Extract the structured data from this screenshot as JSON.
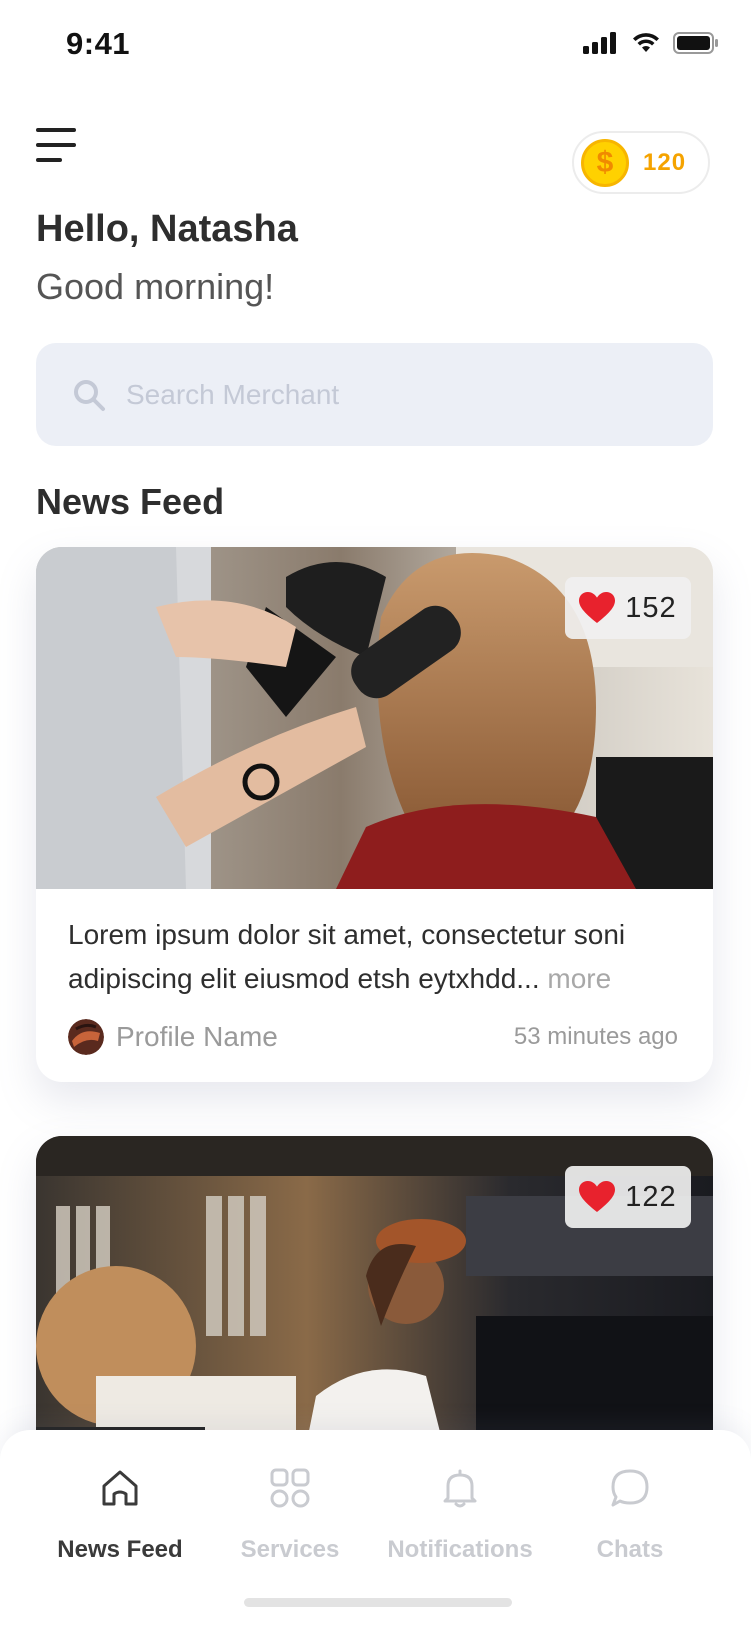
{
  "status_bar": {
    "time": "9:41"
  },
  "header": {
    "coins": "120",
    "coin_symbol": "$",
    "greeting": "Hello, Natasha",
    "subgreeting": "Good morning!"
  },
  "search": {
    "placeholder": "Search Merchant"
  },
  "feed": {
    "title": "News Feed",
    "posts": [
      {
        "likes": "152",
        "text": "Lorem ipsum dolor sit amet, consectetur soni adipiscing elit eiusmod etsh eytxhdd...",
        "more_label": "more",
        "profile_name": "Profile Name",
        "time_ago": "53 minutes ago"
      },
      {
        "likes": "122"
      }
    ]
  },
  "bottom_nav": {
    "items": [
      {
        "label": "News Feed",
        "icon": "home-icon",
        "active": true
      },
      {
        "label": "Services",
        "icon": "grid-icon",
        "active": false
      },
      {
        "label": "Notifications",
        "icon": "bell-icon",
        "active": false
      },
      {
        "label": "Chats",
        "icon": "chat-icon",
        "active": false
      }
    ]
  },
  "colors": {
    "accent_coin": "#f5a300",
    "like_heart": "#e8222d",
    "search_bg": "#eceff6",
    "nav_active": "#3a3a3a",
    "nav_inactive": "#c9cbd0"
  }
}
